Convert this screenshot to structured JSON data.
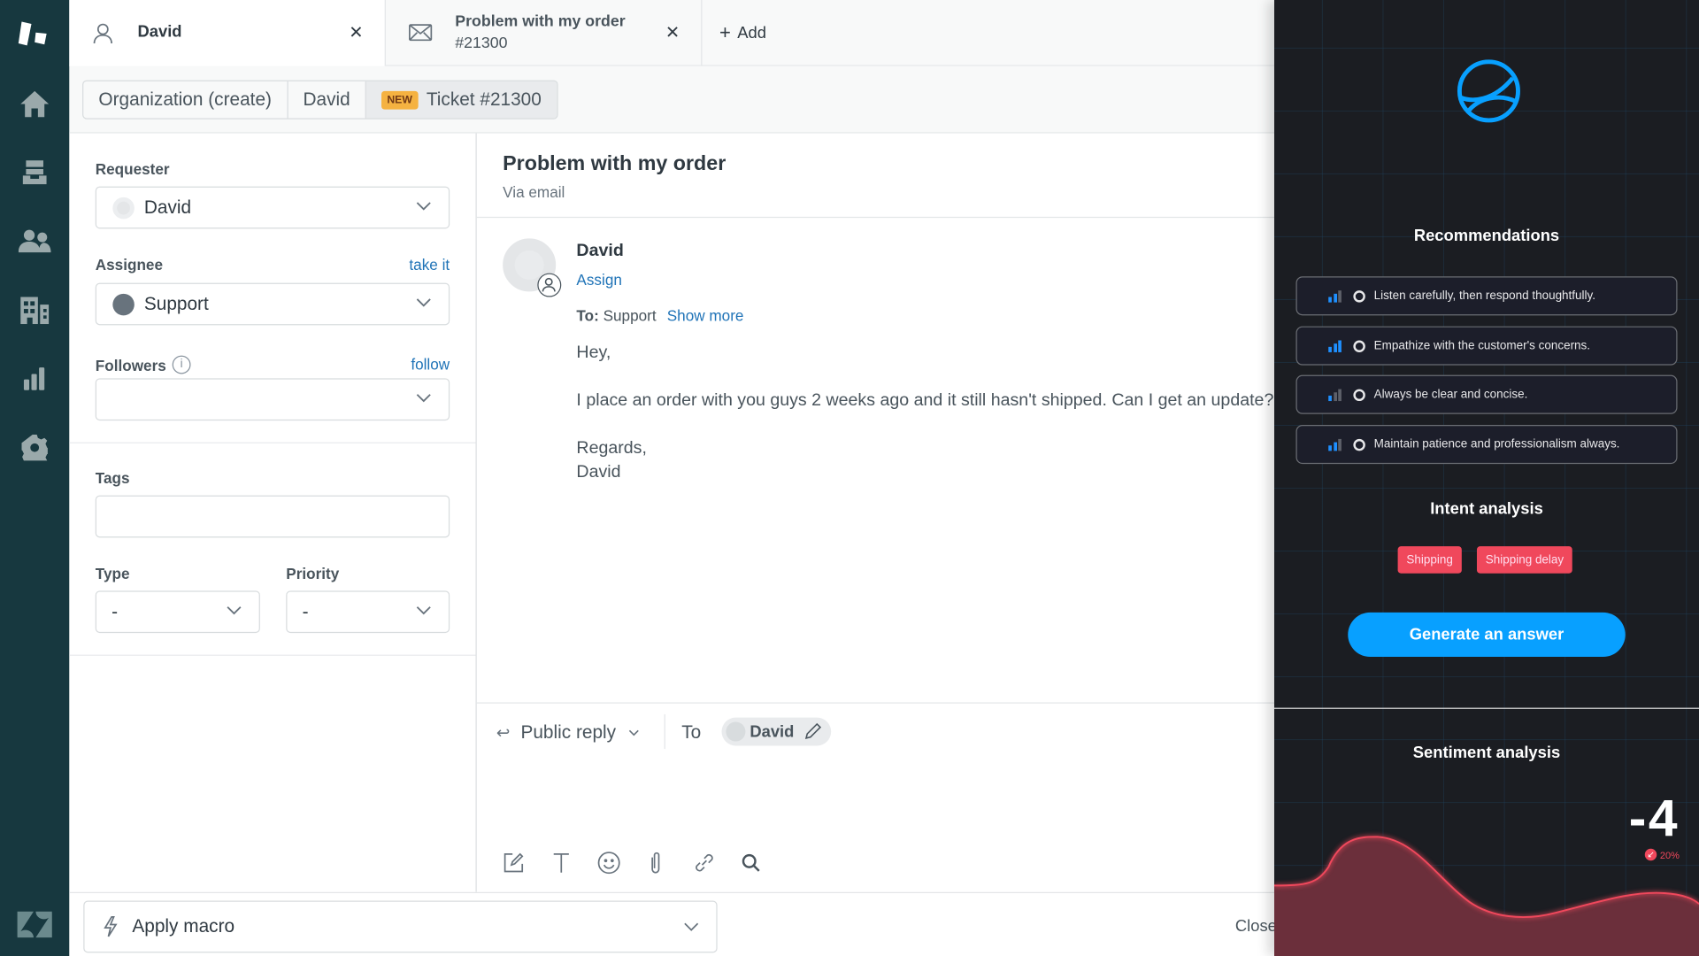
{
  "nav": {
    "items": [
      {
        "name": "logo",
        "icon": "app-logo-icon"
      },
      {
        "name": "home",
        "icon": "home-icon"
      },
      {
        "name": "views",
        "icon": "inbox-icon"
      },
      {
        "name": "customers",
        "icon": "users-icon"
      },
      {
        "name": "organizations",
        "icon": "building-icon"
      },
      {
        "name": "reporting",
        "icon": "bar-chart-icon"
      },
      {
        "name": "admin",
        "icon": "gear-icon"
      },
      {
        "name": "zendesk",
        "icon": "zendesk-logo-icon"
      }
    ]
  },
  "tabs": [
    {
      "title": "David",
      "subtitle": "",
      "icon": "user-icon",
      "active": true
    },
    {
      "title": "Problem with my order",
      "subtitle": "#21300",
      "icon": "mail-icon",
      "active": false
    }
  ],
  "add_tab_label": "Add",
  "breadcrumb": {
    "items": [
      "Organization (create)",
      "David"
    ],
    "badge": "NEW",
    "ticket": "Ticket #21300"
  },
  "props": {
    "requester_label": "Requester",
    "requester_value": "David",
    "assignee_label": "Assignee",
    "assignee_link": "take it",
    "assignee_value": "Support",
    "followers_label": "Followers",
    "followers_link": "follow",
    "followers_value": "",
    "tags_label": "Tags",
    "tags_value": "",
    "type_label": "Type",
    "type_value": "-",
    "priority_label": "Priority",
    "priority_value": "-"
  },
  "conversation": {
    "title": "Problem with my order",
    "channel": "Via email",
    "author": "David",
    "assign_link": "Assign",
    "to_label": "To:",
    "to_value": "Support",
    "show_more": "Show more",
    "body": [
      "Hey,",
      "I place an order with you guys 2 weeks ago and it still hasn't shipped. Can I get an update?",
      "Regards,",
      "David"
    ]
  },
  "composer": {
    "mode": "Public reply",
    "to_label": "To",
    "recipient": "David",
    "tools": [
      "compose-icon",
      "text-format-icon",
      "emoji-icon",
      "attachment-icon",
      "link-icon",
      "search-icon"
    ]
  },
  "bottom": {
    "macro_label": "Apply macro",
    "close_label": "Close"
  },
  "ai_panel": {
    "recommendations_title": "Recommendations",
    "recommendations": [
      {
        "text": "Listen carefully, then respond thoughtfully.",
        "strength": 2
      },
      {
        "text": "Empathize with the customer's concerns.",
        "strength": 3
      },
      {
        "text": "Always be clear and concise.",
        "strength": 1
      },
      {
        "text": "Maintain patience and professionalism always.",
        "strength": 2
      }
    ],
    "strength_max": 3,
    "intent_title": "Intent analysis",
    "intents": [
      "Shipping",
      "Shipping delay"
    ],
    "generate_label": "Generate an answer",
    "sentiment_title": "Sentiment analysis",
    "sentiment_score": "-4",
    "sentiment_change": "20%",
    "colors": {
      "accent": "#08a0ff",
      "negative": "#f0485c"
    }
  }
}
